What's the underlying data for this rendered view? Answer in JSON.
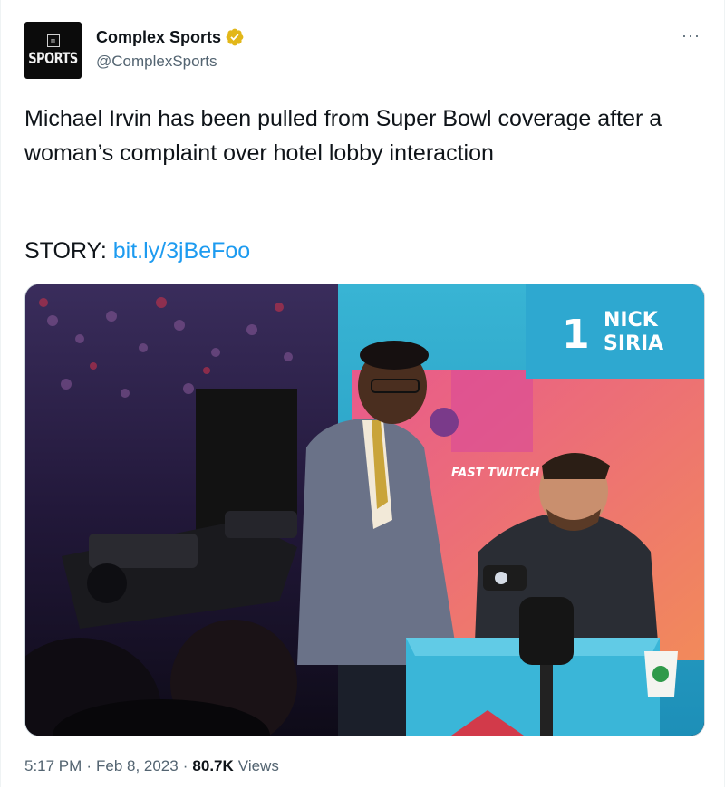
{
  "author": {
    "display_name": "Complex Sports",
    "handle": "@ComplexSports",
    "avatar_text": "SPORTS",
    "avatar_mark": "▥",
    "verified": true
  },
  "menu": {
    "more_label": "···"
  },
  "tweet": {
    "text": "Michael Irvin has been pulled from Super Bowl coverage after a woman’s complaint over hotel lobby interaction",
    "story_prefix": "STORY:",
    "story_link": "bit.ly/3jBeFoo"
  },
  "media": {
    "nameplate_number": "1",
    "nameplate_line1": "NICK",
    "nameplate_line2": "SIRIA",
    "backdrop_text": "FAST TWITCH"
  },
  "meta": {
    "time": "5:17 PM",
    "separator1": "·",
    "date": "Feb 8, 2023",
    "separator2": "·",
    "views_count": "80.7K",
    "views_label": "Views"
  },
  "colors": {
    "link": "#1d9bf0",
    "verified_badge": "#e2b719",
    "secondary_text": "#536471"
  }
}
